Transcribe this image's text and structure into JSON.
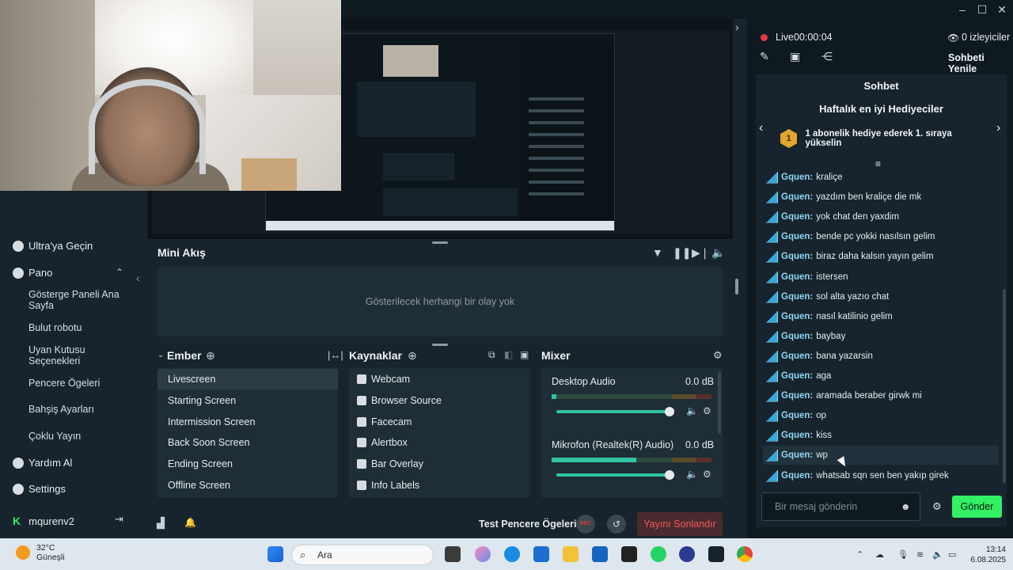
{
  "sidebar": {
    "items": [
      {
        "label": "Ultra'ya Geçin",
        "icon": "ultra-icon"
      },
      {
        "label": "Pano",
        "icon": "dashboard-icon"
      },
      {
        "label": "Yardım Al",
        "icon": "help-icon"
      },
      {
        "label": "Settings",
        "icon": "gear-icon"
      }
    ],
    "sub_items": [
      "Gösterge Paneli Ana Sayfa",
      "Bulut robotu",
      "Uyan Kutusu Seçenekleri",
      "Pencere Ögeleri",
      "Bahşiş Ayarları",
      "Çoklu Yayın"
    ],
    "user": "mqurenv2"
  },
  "mini_feed": {
    "title": "Mini Akış",
    "empty_text": "Gösterilecek herhangi bir olay yok"
  },
  "scenes": {
    "title": "Ember",
    "items": [
      "Livescreen",
      "Starting Screen",
      "Intermission Screen",
      "Back Soon Screen",
      "Ending Screen",
      "Offline Screen"
    ],
    "active": "Livescreen"
  },
  "sources": {
    "title": "Kaynaklar",
    "items": [
      "Webcam",
      "Browser Source",
      "Facecam",
      "Alertbox",
      "Bar Overlay",
      "Info Labels"
    ]
  },
  "mixer": {
    "title": "Mixer",
    "channels": [
      {
        "name": "Desktop Audio",
        "db": "0.0 dB",
        "level": 0.03,
        "volume": 1.0
      },
      {
        "name": "Mikrofon (Realtek(R) Audio)",
        "db": "0.0 dB",
        "level": 0.53,
        "volume": 1.0
      }
    ]
  },
  "bottom_bar": {
    "test_label": "Test Pencere Ögeleri",
    "rec_label": "REC",
    "end_label": "Yayını Sonlandır"
  },
  "stream": {
    "status": "Live",
    "time": "00:00:04",
    "viewers": "0 izleyiciler",
    "refresh_label": "Sohbeti Yenile"
  },
  "chat": {
    "title": "Sohbet",
    "gifters_title": "Haftalık en iyi Hediyeciler",
    "gift_rank": "1",
    "gift_text": "1 abonelik hediye ederek 1. sıraya yükselin",
    "messages": [
      {
        "user": "Gquen:",
        "text": "kraliçe"
      },
      {
        "user": "Gquen:",
        "text": "yazdım ben kraliçe die mk"
      },
      {
        "user": "Gquen:",
        "text": "yok chat den yaxdim"
      },
      {
        "user": "Gquen:",
        "text": "bende pc yokki nasılsın gelim"
      },
      {
        "user": "Gquen:",
        "text": "biraz daha kalsın yayın gelim"
      },
      {
        "user": "Gquen:",
        "text": "istersen"
      },
      {
        "user": "Gquen:",
        "text": "sol alta yazıo chat"
      },
      {
        "user": "Gquen:",
        "text": "nasıl katilinio gelim"
      },
      {
        "user": "Gquen:",
        "text": "baybay"
      },
      {
        "user": "Gquen:",
        "text": "bana yazarsin"
      },
      {
        "user": "Gquen:",
        "text": "aga"
      },
      {
        "user": "Gquen:",
        "text": "aramada beraber girwk mi"
      },
      {
        "user": "Gquen:",
        "text": "op"
      },
      {
        "user": "Gquen:",
        "text": "kiss"
      },
      {
        "user": "Gquen:",
        "text": "wp"
      },
      {
        "user": "Gquen:",
        "text": "whatsab sqn sen ben yakıp girek"
      }
    ],
    "input_placeholder": "Bir mesaj gönderin",
    "send_label": "Gönder"
  },
  "taskbar": {
    "weather_temp": "32°C",
    "weather_desc": "Güneşli",
    "search_placeholder": "Ara",
    "time": "13:14",
    "date": "6.08.2025"
  },
  "colors": {
    "accent": "#31c3a2",
    "send_button": "#31f063",
    "live_dot": "#e3383f",
    "end_stream": "#f05a5a"
  }
}
